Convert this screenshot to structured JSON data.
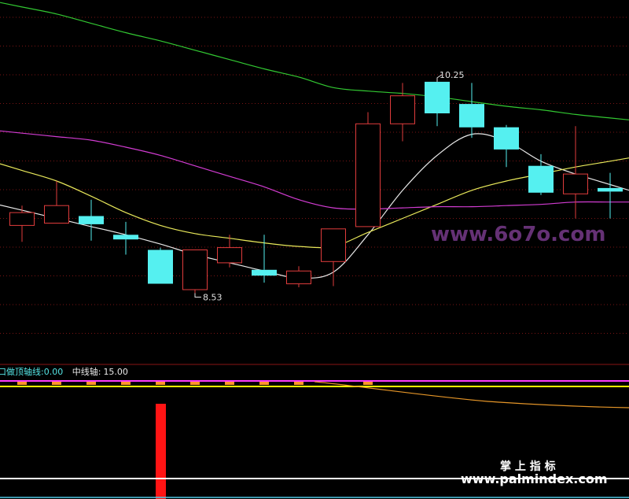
{
  "indicator_bar": {
    "item1_label": "口做顶轴线:",
    "item1_value": "0.00",
    "item2_label": "中线轴:",
    "item2_value": "15.00"
  },
  "watermarks": {
    "upper": "www.6o7o.com",
    "lower_title": "掌 上 指 标",
    "lower_url": "www.palmindex.com"
  },
  "colors": {
    "background": "#000000",
    "up_candle": "#e03c3c",
    "down_candle": "#55f0f0",
    "ma_white": "#e8e8e8",
    "ma_yellow": "#e8e85a",
    "ma_magenta": "#d23cd2",
    "ma_green": "#32c832",
    "grid": "#7a1414",
    "separator": "#8a1414",
    "indicator_label": "#55e6e6",
    "indicator_value": "#e8e8e8",
    "spike": "#ff1414",
    "yellow_hline": "#ffff00",
    "magenta_hline": "#ff3cff",
    "orange_ticks": "#ff9628",
    "orange_curve": "#e69628",
    "white_hline": "#ffffff",
    "cyan_bottom": "#50c8e6"
  },
  "chart_data": {
    "type": "candlestick",
    "price_ylim": [
      7.85,
      10.95
    ],
    "candles": [
      {
        "open": 9.02,
        "close": 9.13,
        "high": 9.19,
        "low": 8.88
      },
      {
        "open": 9.04,
        "close": 9.19,
        "high": 9.4,
        "low": 9.04
      },
      {
        "open": 9.1,
        "close": 9.03,
        "high": 9.24,
        "low": 8.89
      },
      {
        "open": 8.94,
        "close": 8.9,
        "high": 9.05,
        "low": 8.77
      },
      {
        "open": 8.81,
        "close": 8.52,
        "high": 8.83,
        "low": 8.52
      },
      {
        "open": 8.47,
        "close": 8.81,
        "high": 8.81,
        "low": 8.44
      },
      {
        "open": 8.7,
        "close": 8.83,
        "high": 8.94,
        "low": 8.66
      },
      {
        "open": 8.64,
        "close": 8.59,
        "high": 8.94,
        "low": 8.53
      },
      {
        "open": 8.52,
        "close": 8.63,
        "high": 8.67,
        "low": 8.49
      },
      {
        "open": 8.71,
        "close": 8.99,
        "high": 8.99,
        "low": 8.5
      },
      {
        "open": 9.01,
        "close": 9.89,
        "high": 9.99,
        "low": 9.01
      },
      {
        "open": 9.89,
        "close": 10.13,
        "high": 10.24,
        "low": 9.74
      },
      {
        "open": 10.25,
        "close": 9.98,
        "high": 10.25,
        "low": 9.87
      },
      {
        "open": 10.06,
        "close": 9.86,
        "high": 10.24,
        "low": 9.77
      },
      {
        "open": 9.86,
        "close": 9.67,
        "high": 9.88,
        "low": 9.52
      },
      {
        "open": 9.53,
        "close": 9.3,
        "high": 9.63,
        "low": 9.28
      },
      {
        "open": 9.29,
        "close": 9.46,
        "high": 9.87,
        "low": 9.08
      },
      {
        "open": 9.34,
        "close": 9.31,
        "high": 9.47,
        "low": 9.08
      }
    ],
    "max_label": "10.25",
    "min_label": "8.53",
    "moving_averages": [
      {
        "color_key": "ma_white",
        "values": [
          9.15,
          9.08,
          9.01,
          8.94,
          8.86,
          8.77,
          8.7,
          8.63,
          8.57,
          8.62,
          8.94,
          9.32,
          9.62,
          9.8,
          9.74,
          9.57,
          9.46,
          9.37
        ]
      },
      {
        "color_key": "ma_yellow",
        "values": [
          9.49,
          9.4,
          9.27,
          9.13,
          9.02,
          8.95,
          8.91,
          8.87,
          8.84,
          8.84,
          8.96,
          9.08,
          9.2,
          9.32,
          9.4,
          9.46,
          9.52,
          9.57
        ]
      },
      {
        "color_key": "ma_magenta",
        "values": [
          9.81,
          9.78,
          9.75,
          9.69,
          9.62,
          9.53,
          9.44,
          9.35,
          9.24,
          9.17,
          9.16,
          9.17,
          9.18,
          9.18,
          9.19,
          9.2,
          9.22,
          9.22
        ]
      },
      {
        "color_key": "ma_green",
        "values": [
          10.89,
          10.83,
          10.75,
          10.67,
          10.6,
          10.52,
          10.44,
          10.36,
          10.29,
          10.2,
          10.17,
          10.15,
          10.12,
          10.08,
          10.04,
          10.01,
          9.97,
          9.94
        ]
      }
    ],
    "indicator": {
      "spike_index": 4,
      "spike_value": 100,
      "tick_indices": [
        0,
        1,
        2,
        3,
        4,
        5,
        6,
        7,
        8,
        10
      ],
      "axis_lines": [
        0,
        15
      ]
    }
  }
}
